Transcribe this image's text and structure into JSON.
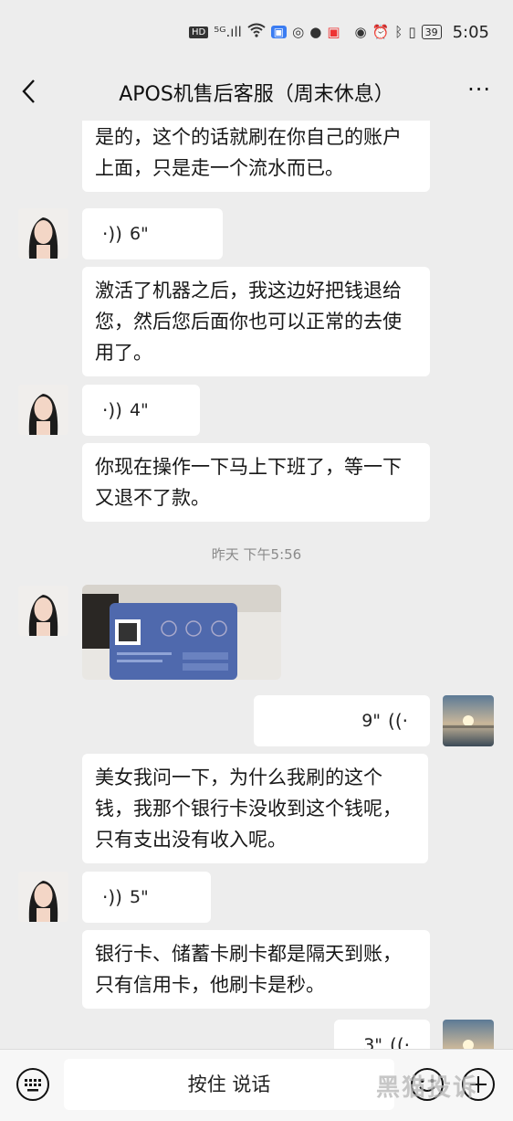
{
  "status_bar": {
    "hd": "HD",
    "signal": "⁵ᴳ.ıll",
    "battery": "39",
    "time": "5:05"
  },
  "nav": {
    "title": "APOS机售后客服（周末休息）",
    "more": "···"
  },
  "messages": [
    {
      "text": "是的，这个的话就刷在你自己的账户上面，只是走一个流水而已。"
    },
    {
      "voice": "6\""
    },
    {
      "text": "激活了机器之后，我这边好把钱退给您，然后您后面你也可以正常的去使用了。"
    },
    {
      "voice": "4\""
    },
    {
      "text": "你现在操作一下马上下班了，等一下又退不了款。"
    },
    {
      "timestamp": "昨天 下午5:56"
    },
    {
      "voice_self": "9\""
    },
    {
      "text": "美女我问一下，为什么我刷的这个钱，我那个银行卡没收到这个钱呢，只有支出没有收入呢。"
    },
    {
      "voice": "5\""
    },
    {
      "text": "银行卡、储蓄卡刷卡都是隔天到账，只有信用卡，他刷卡是秒。"
    },
    {
      "voice_self": "3\""
    }
  ],
  "input_bar": {
    "hold_to_talk": "按住 说话"
  },
  "watermark": "黑猫投诉"
}
